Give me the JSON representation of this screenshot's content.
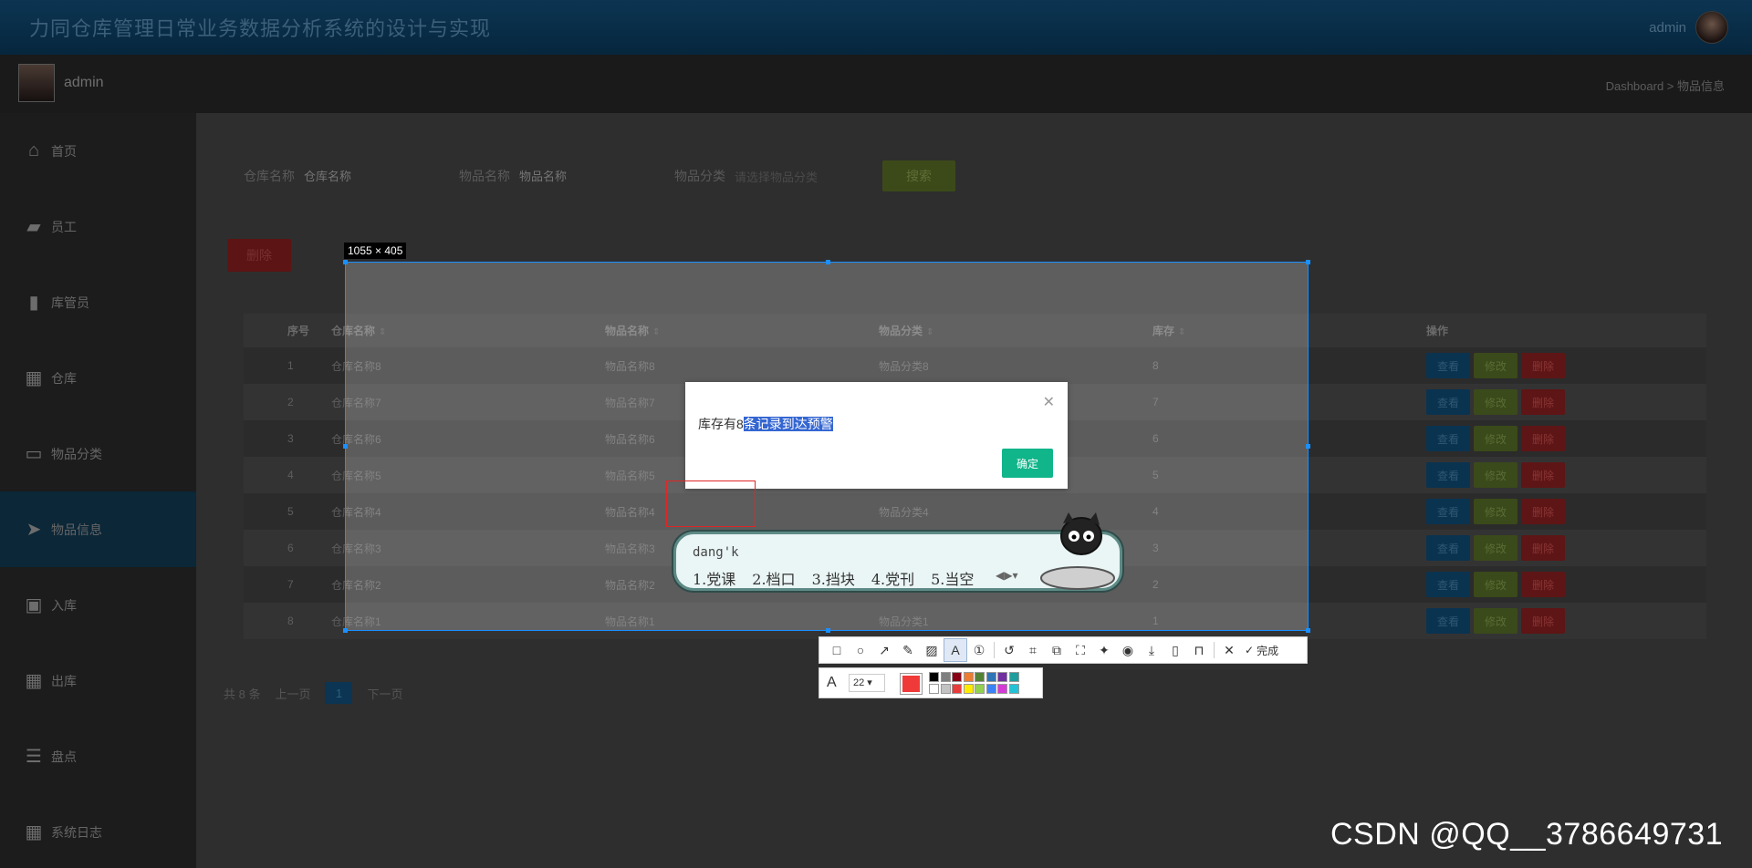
{
  "app": {
    "title": "力同仓库管理日常业务数据分析系统的设计与实现",
    "top_user": "admin"
  },
  "sidebar": {
    "user": "admin",
    "items": [
      {
        "label": "首页",
        "icon": "home-icon"
      },
      {
        "label": "员工",
        "icon": "wallet-icon"
      },
      {
        "label": "库管员",
        "icon": "bar-chart-icon"
      },
      {
        "label": "仓库",
        "icon": "grid-icon"
      },
      {
        "label": "物品分类",
        "icon": "monitor-icon"
      },
      {
        "label": "物品信息",
        "icon": "paper-plane-icon",
        "active": true
      },
      {
        "label": "入库",
        "icon": "briefcase-icon"
      },
      {
        "label": "出库",
        "icon": "grid-icon"
      },
      {
        "label": "盘点",
        "icon": "list-indent-icon"
      },
      {
        "label": "系统日志",
        "icon": "grid-icon"
      }
    ]
  },
  "breadcrumb": "Dashboard > 物品信息",
  "filters": {
    "warehouse_label": "仓库名称",
    "warehouse_placeholder": "仓库名称",
    "item_label": "物品名称",
    "item_placeholder": "物品名称",
    "category_label": "物品分类",
    "category_placeholder": "请选择物品分类",
    "search_button": "搜索"
  },
  "delete_button": "删除",
  "table": {
    "headers": [
      "序号",
      "仓库名称",
      "物品名称",
      "物品分类",
      "库存",
      "操作"
    ],
    "rows": [
      [
        "1",
        "仓库名称8",
        "物品名称8",
        "物品分类8",
        "8"
      ],
      [
        "2",
        "仓库名称7",
        "物品名称7",
        "",
        "7"
      ],
      [
        "3",
        "仓库名称6",
        "物品名称6",
        "",
        "6"
      ],
      [
        "4",
        "仓库名称5",
        "物品名称5",
        "",
        "5"
      ],
      [
        "5",
        "仓库名称4",
        "物品名称4",
        "物品分类4",
        "4"
      ],
      [
        "6",
        "仓库名称3",
        "物品名称3",
        "",
        "3"
      ],
      [
        "7",
        "仓库名称2",
        "物品名称2",
        "",
        "2"
      ],
      [
        "8",
        "仓库名称1",
        "物品名称1",
        "物品分类1",
        "1"
      ]
    ],
    "ops": {
      "view": "查看",
      "edit": "修改",
      "delete": "删除"
    }
  },
  "pager": {
    "total": "共 8 条",
    "prev": "上一页",
    "current": "1",
    "next": "下一页"
  },
  "screenshot": {
    "size_label": "1055 × 405"
  },
  "dialog": {
    "message_plain": "库存有8",
    "message_highlight": "条记录到达预警",
    "ok_button": "确定"
  },
  "ime": {
    "composition": "dang'k",
    "candidates": [
      "1.党课",
      "2.档口",
      "3.挡块",
      "4.党刊",
      "5.当空"
    ]
  },
  "toolbar": {
    "done_label": "完成",
    "font_size": "22",
    "current_color": "#f03a3a",
    "palette": [
      "#000000",
      "#7f7f7f",
      "#880015",
      "#ed7d31",
      "#548235",
      "#2e75b6",
      "#7030a0",
      "#1f9e9e",
      "#ffffff",
      "#c3c3c3",
      "#e83b3b",
      "#ffeb00",
      "#92d050",
      "#3b82f6",
      "#d63ad6",
      "#22c3d6"
    ]
  },
  "watermark": "CSDN @QQ__3786649731"
}
